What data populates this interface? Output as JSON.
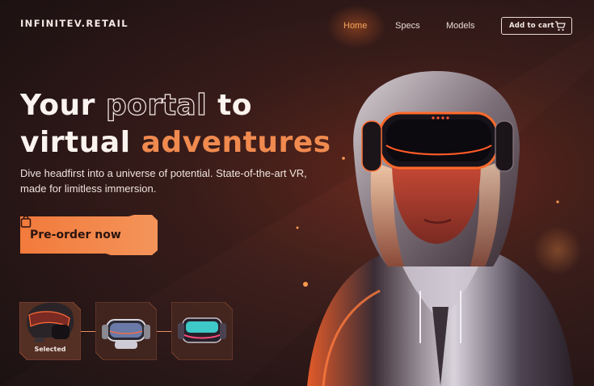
{
  "brand": {
    "logo_text": "INFINITEV.RETAIL"
  },
  "nav": {
    "items": [
      {
        "label": "Home",
        "active": true
      },
      {
        "label": "Specs",
        "active": false
      },
      {
        "label": "Models",
        "active": false
      }
    ],
    "cart_label": "Add to cart",
    "cart_icon": "cart-icon"
  },
  "hero": {
    "headline_line1_a": "Your",
    "headline_line1_b": "portal",
    "headline_line1_c": "to",
    "headline_line2_a": "virtual",
    "headline_line2_b": "adventures",
    "subtext": "Dive headfirst into a universe of potential. State-of-the-art VR, made for limitless immersion.",
    "cta_label": "Pre-order now",
    "cta_icon": "shopping-bag-icon"
  },
  "models": [
    {
      "name": "headset-helmet-thumb",
      "label": "Selected",
      "selected": true
    },
    {
      "name": "headset-chrome-thumb",
      "label": "",
      "selected": false
    },
    {
      "name": "headset-teal-thumb",
      "label": "",
      "selected": false
    }
  ],
  "colors": {
    "accent": "#f08a4f",
    "nav_active": "#f2a55a",
    "background": "#2a1818",
    "text": "#fbf3ee"
  }
}
